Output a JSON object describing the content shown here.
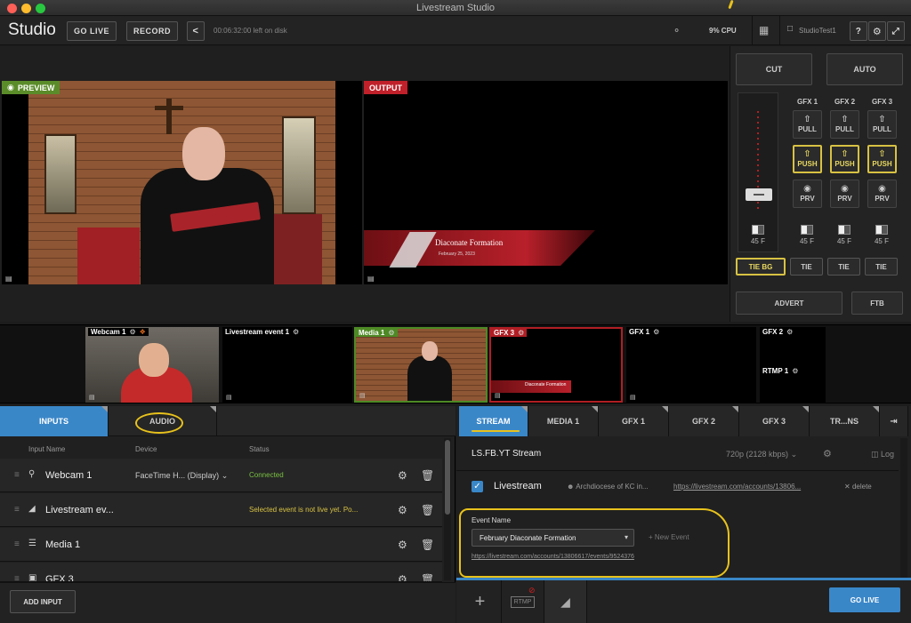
{
  "window": {
    "title": "Livestream Studio"
  },
  "toolbar": {
    "brand": "Studio",
    "go_live": "GO LIVE",
    "record": "RECORD",
    "disk": "00:06:32:00 left on disk",
    "cpu": "9% CPU",
    "project": "StudioTest1"
  },
  "monitors": {
    "preview_label": "PREVIEW",
    "output_label": "OUTPUT",
    "lower_third_title": "Diaconate Formation",
    "lower_third_date": "February 25, 2023"
  },
  "switcher": {
    "cut": "CUT",
    "auto": "AUTO",
    "gfx_columns": [
      "GFX 1",
      "GFX 2",
      "GFX 3"
    ],
    "pull": "PULL",
    "push": "PUSH",
    "prv": "PRV",
    "transition_frames": "45 F",
    "tie_bg": "TIE BG",
    "tie": "TIE",
    "advert": "ADVERT",
    "ftb": "FTB"
  },
  "sources": [
    {
      "name": "Webcam 1"
    },
    {
      "name": "Livestream event 1"
    },
    {
      "name": "Media 1"
    },
    {
      "name": "GFX 3"
    },
    {
      "name": "GFX 1"
    },
    {
      "name": "GFX 2"
    },
    {
      "name": "RTMP 1"
    }
  ],
  "inputs_panel": {
    "tabs": [
      "INPUTS",
      "AUDIO"
    ],
    "headers": [
      "Input Name",
      "Device",
      "Status"
    ],
    "rows": [
      {
        "name": "Webcam 1",
        "device": "FaceTime H... (Display)",
        "status": "Connected",
        "status_color": "#7ac143"
      },
      {
        "name": "Livestream ev...",
        "device": "",
        "status": "Selected event is not live yet. Po...",
        "status_color": "#d8c243"
      },
      {
        "name": "Media 1",
        "device": "",
        "status": "",
        "status_color": "#ccc"
      },
      {
        "name": "GFX 3",
        "device": "",
        "status": "",
        "status_color": "#ccc"
      }
    ],
    "add_input": "ADD INPUT"
  },
  "stream_panel": {
    "tabs": [
      "STREAM",
      "MEDIA 1",
      "GFX 1",
      "GFX 2",
      "GFX 3",
      "TR...NS"
    ],
    "stream_name": "LS.FB.YT Stream",
    "quality": "720p (2128 kbps)",
    "log": "Log",
    "destination": "Livestream",
    "account": "Archdiocese of KC in...",
    "account_url": "https://livestream.com/accounts/13806...",
    "delete": "delete",
    "event_name_label": "Event Name",
    "event_selected": "February Diaconate Formation",
    "new_event": "New Event",
    "event_url": "https://livestream.com/accounts/13806617/events/9524376",
    "rtmp_label": "RTMP",
    "go_live": "GO LIVE"
  },
  "colors": {
    "accent": "#3a87c8",
    "preview": "#5b8c2a",
    "output": "#c0202a",
    "annotation": "#e8c21c"
  }
}
